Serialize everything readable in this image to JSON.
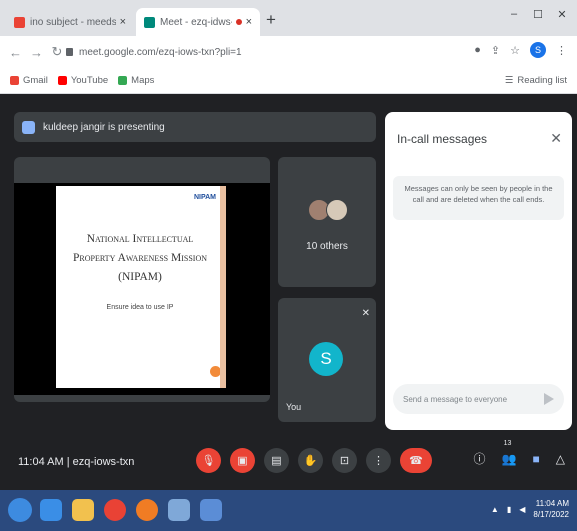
{
  "browser": {
    "tabs": [
      {
        "title": "ino subject - meeds temarus",
        "favicon_color": "#ea4335"
      },
      {
        "title": "Meet - ezq-idws-txn",
        "favicon_color": "#00897b"
      }
    ],
    "url": "meet.google.com/ezq-iows-txn?pli=1",
    "profile_initial": "S",
    "bookmarks": [
      {
        "label": "Gmail",
        "color": "#ea4335"
      },
      {
        "label": "YouTube",
        "color": "#ff0000"
      },
      {
        "label": "Maps",
        "color": "#34a853"
      }
    ],
    "reading_list": "Reading list"
  },
  "meet": {
    "presenting_banner": "kuldeep jangir is presenting",
    "slide": {
      "brand": "NIPAM",
      "title_lines": [
        "National Intellectual",
        "Property Awareness Mission",
        "(NIPAM)"
      ],
      "subtitle": "Ensure idea to use IP"
    },
    "others_label": "10 others",
    "you_label": "You",
    "you_initial": "S",
    "chat": {
      "title": "In-call messages",
      "info": "Messages can only be seen by people in the call and are deleted when the call ends.",
      "input_placeholder": "Send a message to everyone"
    },
    "meeting_info": "11:04 AM  |  ezq-iows-txn",
    "participant_count": "13"
  },
  "taskbar": {
    "apps": [
      {
        "name": "ie",
        "color": "#3a8ee6"
      },
      {
        "name": "folder",
        "color": "#f2c14e"
      },
      {
        "name": "chrome",
        "color": "#e94235"
      },
      {
        "name": "firefox",
        "color": "#f07c24"
      },
      {
        "name": "explorer",
        "color": "#7fa8d8"
      },
      {
        "name": "doc",
        "color": "#5b8dd6"
      }
    ],
    "time": "11:04 AM",
    "date": "8/17/2022"
  }
}
